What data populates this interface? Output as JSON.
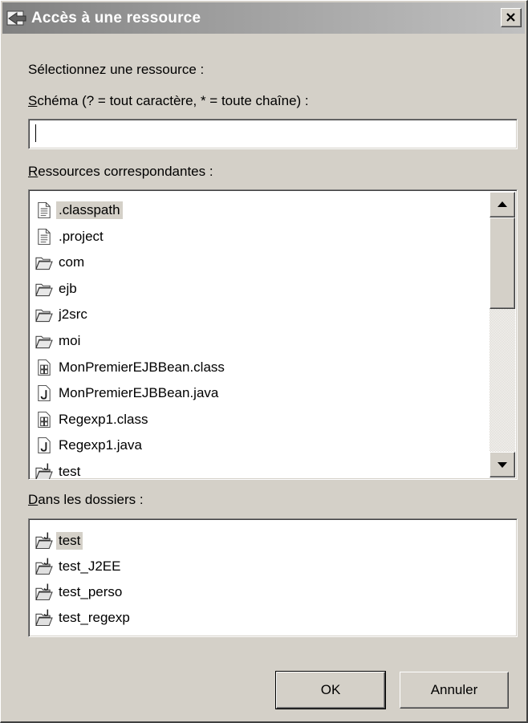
{
  "window": {
    "title": "Accès à une ressource",
    "close_label": "X"
  },
  "prompt": "Sélectionnez une ressource :",
  "pattern": {
    "mnemonic": "S",
    "label_rest": "chéma (? = tout caractère, * = toute chaîne) :",
    "value": ""
  },
  "matching": {
    "mnemonic": "R",
    "label_rest": "essources correspondantes :",
    "items": [
      {
        "label": ".classpath",
        "icon": "text-file-icon",
        "selected": true
      },
      {
        "label": ".project",
        "icon": "text-file-icon"
      },
      {
        "label": "com",
        "icon": "folder-icon"
      },
      {
        "label": "ejb",
        "icon": "folder-icon"
      },
      {
        "label": "j2src",
        "icon": "folder-icon"
      },
      {
        "label": "moi",
        "icon": "folder-icon"
      },
      {
        "label": "MonPremierEJBBean.class",
        "icon": "class-file-icon"
      },
      {
        "label": "MonPremierEJBBean.java",
        "icon": "java-file-icon"
      },
      {
        "label": "Regexp1.class",
        "icon": "class-file-icon"
      },
      {
        "label": "Regexp1.java",
        "icon": "java-file-icon"
      },
      {
        "label": "test",
        "icon": "java-project-icon"
      }
    ],
    "scroll_fraction": 0.0
  },
  "folders": {
    "mnemonic": "D",
    "label_rest": "ans les dossiers :",
    "items": [
      {
        "label": "test",
        "icon": "java-project-icon",
        "selected": true
      },
      {
        "label": "test_J2EE",
        "icon": "java-project-icon"
      },
      {
        "label": "test_perso",
        "icon": "java-project-icon"
      },
      {
        "label": "test_regexp",
        "icon": "java-project-icon"
      }
    ]
  },
  "buttons": {
    "ok": "OK",
    "cancel": "Annuler"
  },
  "colors": {
    "titlebar_start": "#808080",
    "titlebar_end": "#c0c0c0",
    "face": "#d4d0c8"
  }
}
